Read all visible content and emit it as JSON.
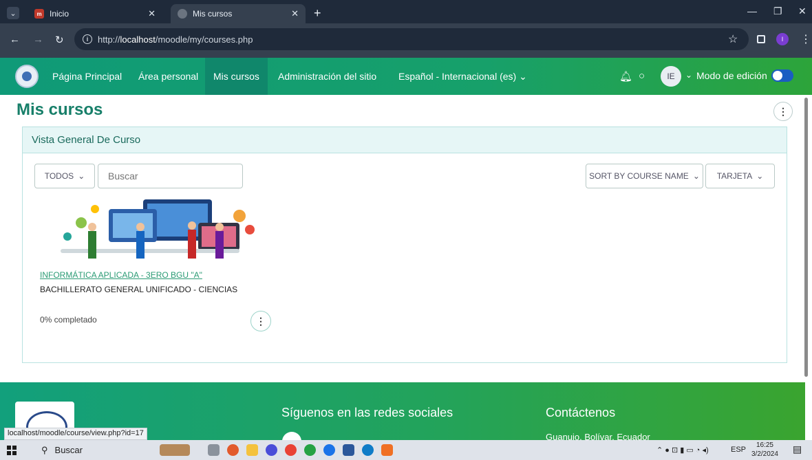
{
  "browser": {
    "tabs": [
      {
        "title": "Inicio"
      },
      {
        "title": "Mis cursos"
      }
    ],
    "url_prefix": "http://",
    "url_host": "localhost",
    "url_path": "/moodle/my/courses.php"
  },
  "navbar": {
    "items": [
      {
        "label": "Página Principal"
      },
      {
        "label": "Área personal"
      },
      {
        "label": "Mis cursos"
      },
      {
        "label": "Administración del sitio"
      },
      {
        "label": "Español - Internacional (es) ⌄"
      }
    ],
    "avatar_initials": "IE",
    "edit_mode_label": "Modo de edición"
  },
  "page": {
    "title": "Mis cursos",
    "block_title": "Vista General De Curso",
    "filter_label": "TODOS",
    "search_placeholder": "Buscar",
    "sort_label": "SORT BY COURSE NAME",
    "view_label": "TARJETA",
    "course": {
      "name": "INFORMÁTICA APLICADA - 3ERO BGU \"A\"",
      "category": "BACHILLERATO GENERAL UNIFICADO - CIENCIAS",
      "progress_text": "0% completado"
    }
  },
  "footer": {
    "social_heading": "Síguenos en las redes sociales",
    "contact_heading": "Contáctenos",
    "contact_location": "Guanujo, Bolívar, Ecuador"
  },
  "status_url": "localhost/moodle/course/view.php?id=17",
  "taskbar": {
    "search_label": "Buscar",
    "language": "ESP",
    "time": "16:25",
    "date": "3/2/2024"
  }
}
